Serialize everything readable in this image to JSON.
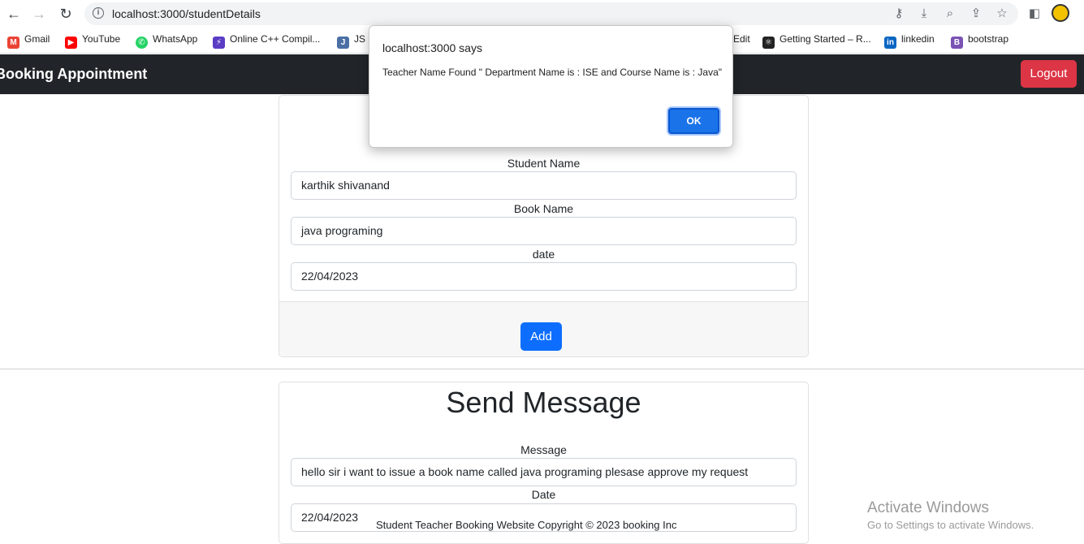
{
  "browser": {
    "url": "localhost:3000/studentDetails",
    "bookmarks": [
      {
        "label": "Gmail",
        "icon": "gmail-icon",
        "color": "#ea4335"
      },
      {
        "label": "YouTube",
        "icon": "youtube-icon",
        "color": "#ff0000"
      },
      {
        "label": "WhatsApp",
        "icon": "whatsapp-icon",
        "color": "#25d366"
      },
      {
        "label": "Online C++ Compil...",
        "icon": "compiler-icon",
        "color": "#5b3cc4"
      },
      {
        "label": "JS I",
        "icon": "js-icon",
        "color": "#4a6fa5"
      },
      {
        "label": "Edit",
        "icon": "",
        "color": ""
      },
      {
        "label": "Getting Started – R...",
        "icon": "react-icon",
        "color": "#222222"
      },
      {
        "label": "linkedin",
        "icon": "linkedin-icon",
        "color": "#0a66c2"
      },
      {
        "label": "bootstrap",
        "icon": "bootstrap-icon",
        "color": "#7952b3"
      }
    ]
  },
  "navbar": {
    "brand": "Booking Appointment",
    "logout_label": "Logout"
  },
  "booking_form": {
    "student_name_label": "Student Name",
    "student_name_value": "karthik shivanand",
    "book_name_label": "Book Name",
    "book_name_value": "java programing",
    "date_label": "date",
    "date_value": "22/04/2023",
    "add_label": "Add"
  },
  "message_form": {
    "title": "Send Message",
    "message_label": "Message",
    "message_value": "hello sir i want to issue a book name called java programing plesase approve my request",
    "date_label": "Date",
    "date_value": "22/04/2023"
  },
  "footer": {
    "text": "Student Teacher Booking Website Copyright © 2023 booking Inc"
  },
  "dialog": {
    "title": "localhost:3000 says",
    "message": "Teacher Name Found \" Department Name is : ISE and Course Name is : Java\"",
    "ok_label": "OK"
  },
  "watermark": {
    "line1": "Activate Windows",
    "line2": "Go to Settings to activate Windows."
  },
  "colors": {
    "navbar": "#212529",
    "logout": "#dc3545",
    "primary": "#0d6efd",
    "dialog_ok": "#1a73e8"
  }
}
